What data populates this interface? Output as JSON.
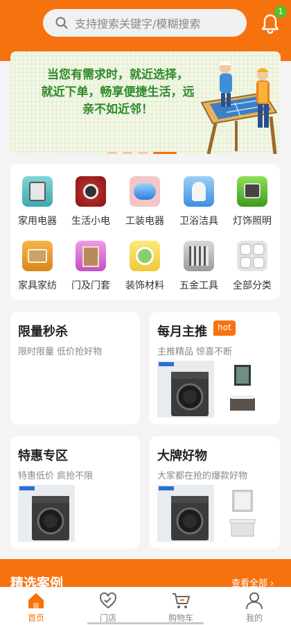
{
  "header": {
    "search_placeholder": "支持搜索关键字/模糊搜索",
    "notification_count": "1",
    "accent": "#f6720f"
  },
  "banner": {
    "line1": "当您有需求时，就近选择，",
    "line2": "就近下单，畅享便捷生活，远",
    "line3": "亲不如近邻！",
    "page_count": 4,
    "active_page": 4
  },
  "categories": [
    {
      "label": "家用电器",
      "icon": "appliance-icon"
    },
    {
      "label": "生活小电",
      "icon": "small-appliance-icon"
    },
    {
      "label": "工装电器",
      "icon": "industrial-appliance-icon"
    },
    {
      "label": "卫浴洁具",
      "icon": "bathroom-icon"
    },
    {
      "label": "灯饰照明",
      "icon": "lighting-icon"
    },
    {
      "label": "家具家纺",
      "icon": "furniture-icon"
    },
    {
      "label": "门及门套",
      "icon": "door-icon"
    },
    {
      "label": "装饰材料",
      "icon": "decoration-icon"
    },
    {
      "label": "五金工具",
      "icon": "hardware-icon"
    },
    {
      "label": "全部分类",
      "icon": "all-categories-icon"
    }
  ],
  "promos": {
    "flash_sale": {
      "title": "限量秒杀",
      "subtitle": "限时限量 低价抢好物"
    },
    "monthly_pick": {
      "title": "每月主推",
      "subtitle": "主推精品 惊喜不断",
      "badge": "hot"
    },
    "special_offer": {
      "title": "特惠专区",
      "subtitle": "特惠低价 疯抢不限"
    },
    "big_brand": {
      "title": "大牌好物",
      "subtitle": "大家都在抢的爆款好物"
    }
  },
  "featured": {
    "title": "精选案例",
    "more": "查看全部"
  },
  "tabbar": {
    "items": [
      {
        "label": "首页",
        "icon": "home-icon",
        "active": true
      },
      {
        "label": "门店",
        "icon": "store-icon",
        "active": false
      },
      {
        "label": "购物车",
        "icon": "cart-icon",
        "active": false
      },
      {
        "label": "我的",
        "icon": "profile-icon",
        "active": false
      }
    ]
  }
}
